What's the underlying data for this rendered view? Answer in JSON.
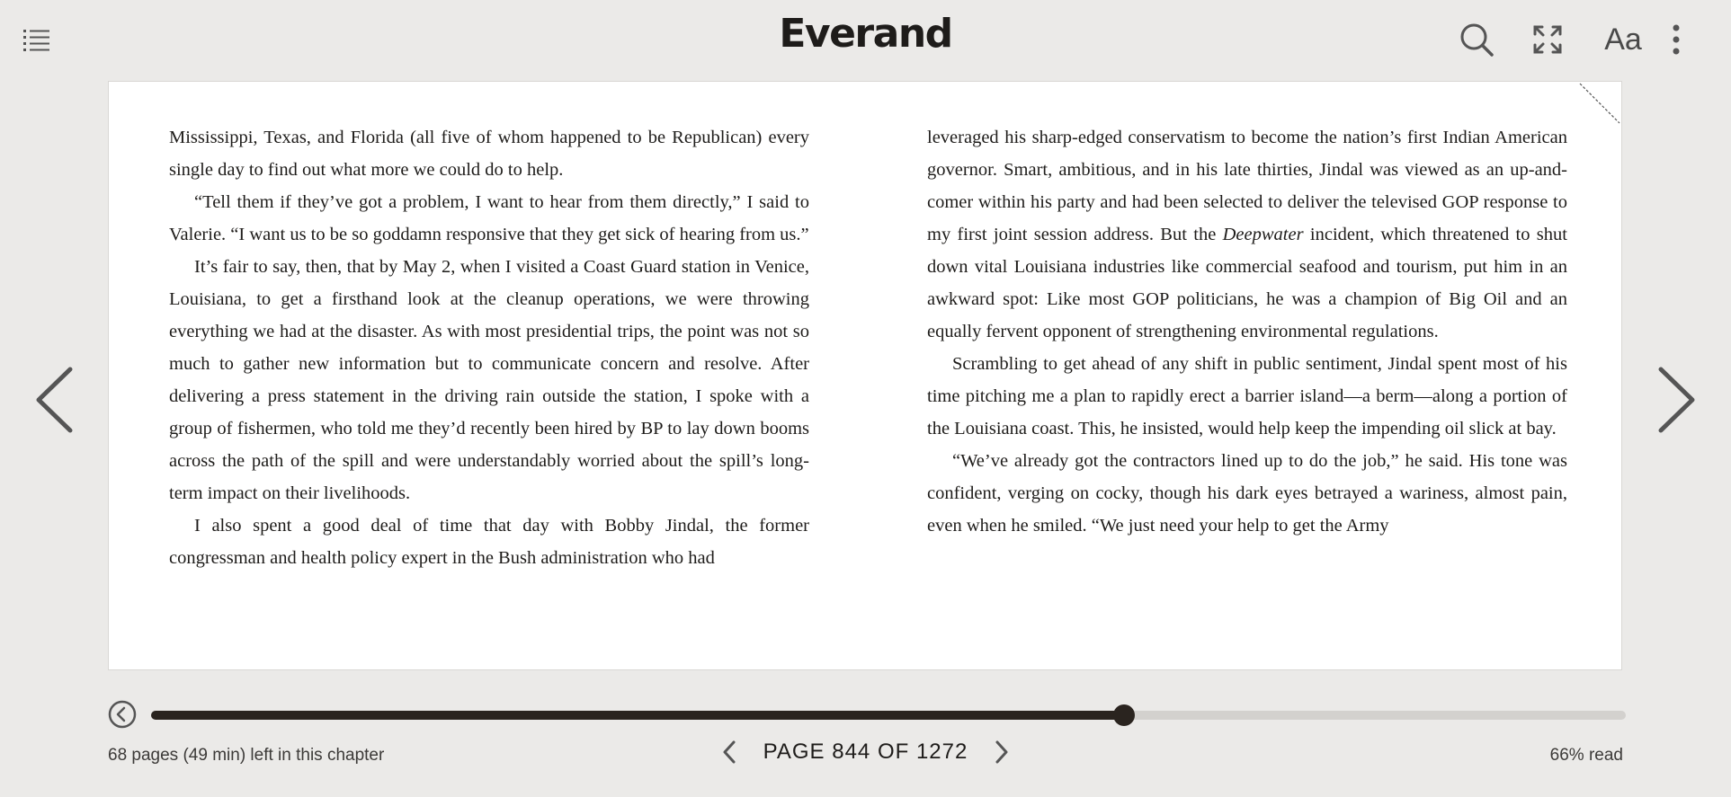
{
  "header": {
    "brand": "Everand",
    "icons": [
      "list-icon",
      "search-icon",
      "fullscreen-icon",
      "font-settings-icon",
      "more-vertical-icon"
    ],
    "font_settings_label": "Aa"
  },
  "reader": {
    "left_column": [
      {
        "indent": false,
        "html": "Mississippi, Texas, and Florida (all five of whom happened to be Republican) every single day to find out what more we could do to help."
      },
      {
        "indent": true,
        "html": "“Tell them if they’ve got a problem, I want to hear from them directly,” I said to Valerie. “I want us to be so goddamn responsive that they get sick of hearing from us.”"
      },
      {
        "indent": true,
        "html": "It’s fair to say, then, that by May 2, when I visited a Coast Guard station in Venice, Louisiana, to get a firsthand look at the cleanup operations, we were throwing everything we had at the disaster. As with most presidential trips, the point was not so much to gather new information but to communicate concern and resolve. After delivering a press statement in the driving rain outside the station, I spoke with a group of fishermen, who told me they’d recently been hired by BP to lay down booms across the path of the spill and were understandably worried about the spill’s long-term impact on their livelihoods."
      },
      {
        "indent": true,
        "html": "I also spent a good deal of time that day with Bobby Jindal, the former congressman and health policy expert in the Bush administration who had"
      }
    ],
    "right_column": [
      {
        "indent": false,
        "html": "leveraged his sharp-edged conservatism to become the nation’s first Indian American governor. Smart, ambitious, and in his late thirties, Jindal was viewed as an up-and-comer within his party and had been selected to deliver the televised GOP response to my first joint session address. But the Deepwater incident, which threatened to shut down vital Louisiana industries like commercial seafood and tourism, put him in an awkward spot: Like most GOP politicians, he was a champion of Big Oil and an equally fervent opponent of strengthening environmental regulations."
      },
      {
        "indent": true,
        "html": "Scrambling to get ahead of any shift in public sentiment, Jindal spent most of his time pitching me a plan to rapidly erect a barrier island—a berm—along a portion of the Louisiana coast. This, he insisted, would help keep the impending oil slick at bay."
      },
      {
        "indent": true,
        "html": "“We’ve already got the contractors lined up to do the job,” he said. His tone was confident, verging on cocky, though his dark eyes betrayed a wariness, almost pain, even when he smiled. “We just need your help to get the Army"
      }
    ],
    "italic_word": "Deepwater"
  },
  "progress": {
    "fraction_read": 0.66,
    "chapter_remaining": "68 pages (49 min) left in this chapter",
    "page_label": "PAGE 844 OF 1272",
    "percent_read": "66% read"
  },
  "colors": {
    "background": "#ebeae8",
    "page": "#ffffff",
    "ink": "#1e1c1a",
    "track": "#d3d1ce",
    "fill": "#2a241f"
  }
}
